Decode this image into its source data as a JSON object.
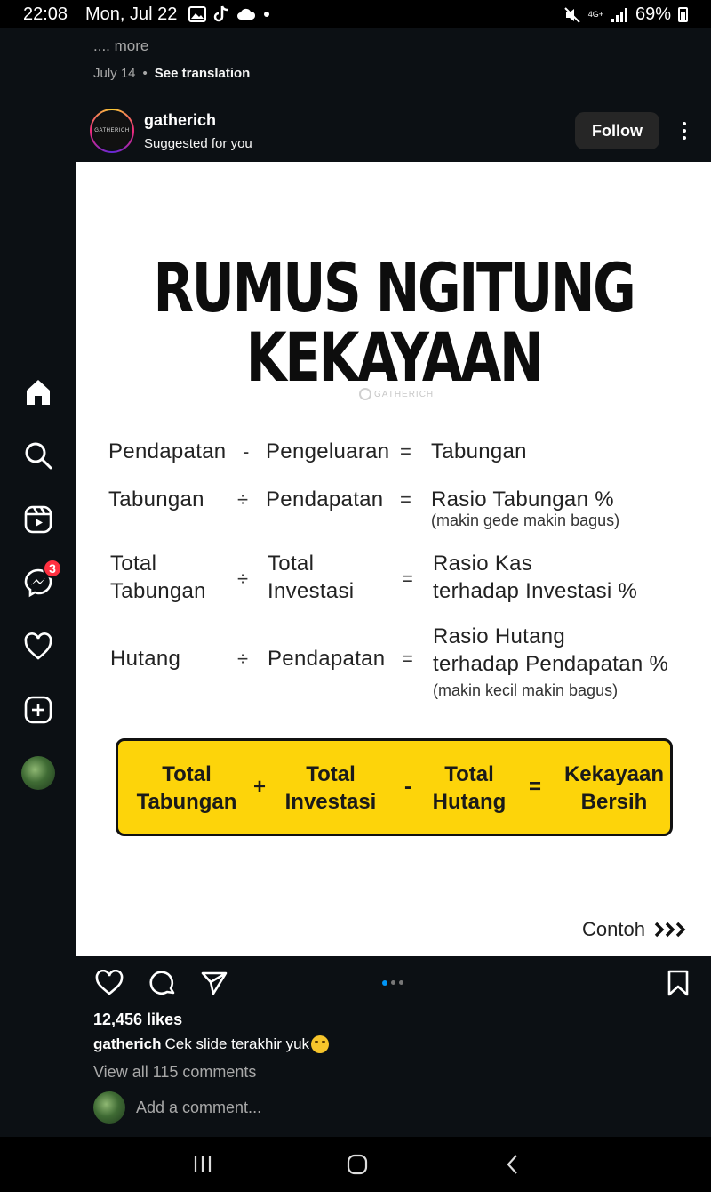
{
  "status_bar": {
    "time": "22:08",
    "date": "Mon, Jul 22",
    "network": "4G+",
    "battery": "69%"
  },
  "rail": {
    "items": [
      "home-icon",
      "search-icon",
      "reels-icon",
      "messenger-icon",
      "heart-icon",
      "create-icon"
    ],
    "messenger_badge": "3"
  },
  "previous_post": {
    "more_label": ".... more",
    "date": "July 14",
    "separator": "•",
    "see_translation": "See translation"
  },
  "post": {
    "username": "gatherich",
    "subtitle": "Suggested for you",
    "follow_label": "Follow",
    "avatar_text": "GATHERICH",
    "image": {
      "title_line1": "RUMUS NGITUNG",
      "title_line2": "KEKAYAAN",
      "watermark": "GATHERICH",
      "rows": [
        {
          "a": "Pendapatan",
          "op1": "-",
          "b": "Pengeluaran",
          "op2": "=",
          "c": "Tabungan"
        },
        {
          "a": "Tabungan",
          "op1": "÷",
          "b": "Pendapatan",
          "op2": "=",
          "c": "Rasio Tabungan %",
          "note": "(makin gede makin bagus)"
        },
        {
          "a1": "Total",
          "a2": "Tabungan",
          "op1": "÷",
          "b1": "Total",
          "b2": "Investasi",
          "op2": "=",
          "c1": "Rasio Kas",
          "c2": "terhadap Investasi %"
        },
        {
          "a": "Hutang",
          "op1": "÷",
          "b": "Pendapatan",
          "op2": "=",
          "c1": "Rasio Hutang",
          "c2": "terhadap Pendapatan %",
          "note": "(makin kecil makin bagus)"
        }
      ],
      "summary": {
        "t1a": "Total",
        "t1b": "Tabungan",
        "op1": "+",
        "t2a": "Total",
        "t2b": "Investasi",
        "op2": "-",
        "t3a": "Total",
        "t3b": "Hutang",
        "op3": "=",
        "t4a": "Kekayaan",
        "t4b": "Bersih"
      },
      "contoh": "Contoh"
    },
    "likes": "12,456 likes",
    "caption_user": "gatherich",
    "caption_text": "Cek slide terakhir yuk",
    "view_comments": "View all 115 comments",
    "comment_placeholder": "Add a comment..."
  },
  "colors": {
    "background": "#0c1014",
    "yellow": "#fdd40a",
    "badge": "#ff3040",
    "dot_active": "#0095f6"
  }
}
